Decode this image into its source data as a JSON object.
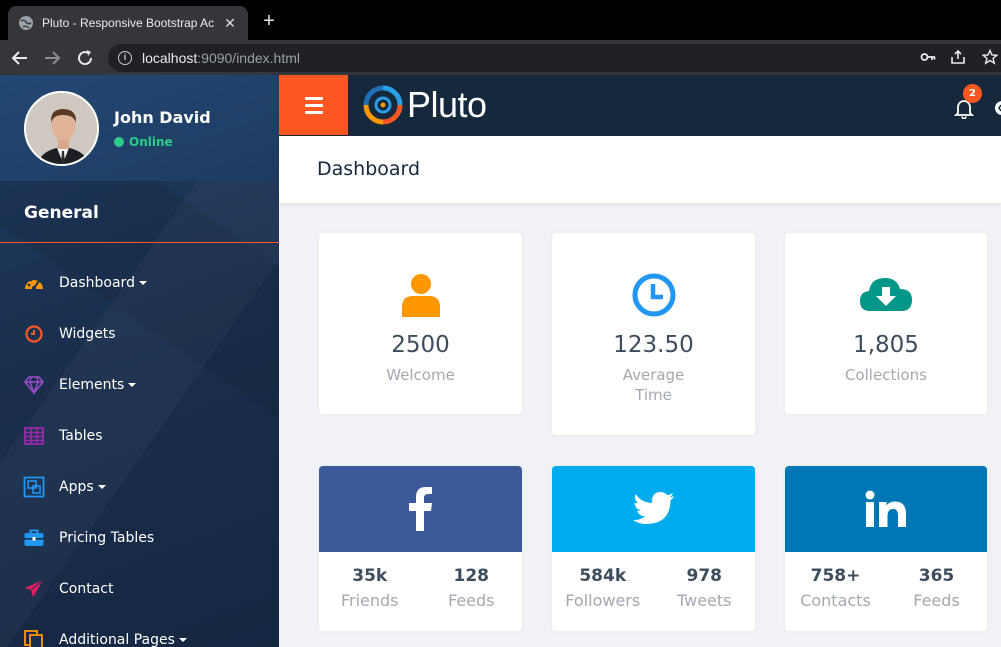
{
  "browser": {
    "tab_title": "Pluto - Responsive Bootstrap Ac",
    "url_host": "localhost",
    "url_rest": ":9090/index.html"
  },
  "sidebar": {
    "user_name": "John David",
    "user_status": "Online",
    "section_title": "General",
    "items": [
      {
        "label": "Dashboard",
        "icon": "dashboard-icon",
        "dropdown": true,
        "color": "#ff9800"
      },
      {
        "label": "Widgets",
        "icon": "clock-icon",
        "dropdown": false,
        "color": "#ff5722"
      },
      {
        "label": "Elements",
        "icon": "diamond-icon",
        "dropdown": true,
        "color": "#9c4dcc"
      },
      {
        "label": "Tables",
        "icon": "table-icon",
        "dropdown": false,
        "color": "#9c27b0"
      },
      {
        "label": "Apps",
        "icon": "apps-icon",
        "dropdown": true,
        "color": "#2196f3"
      },
      {
        "label": "Pricing Tables",
        "icon": "briefcase-icon",
        "dropdown": false,
        "color": "#2196f3"
      },
      {
        "label": "Contact",
        "icon": "paper-plane-icon",
        "dropdown": false,
        "color": "#e91e63"
      },
      {
        "label": "Additional Pages",
        "icon": "copy-icon",
        "dropdown": true,
        "color": "#ff9800"
      }
    ]
  },
  "topbar": {
    "brand": "Pluto",
    "notification_count": "2"
  },
  "page": {
    "title": "Dashboard"
  },
  "stats": [
    {
      "value": "2500",
      "label": "Welcome",
      "label2": "",
      "icon": "user-icon",
      "color": "#ff9800"
    },
    {
      "value": "123.50",
      "label": "Average",
      "label2": "Time",
      "icon": "clock-icon",
      "color": "#2196f3"
    },
    {
      "value": "1,805",
      "label": "Collections",
      "label2": "",
      "icon": "cloud-download-icon",
      "color": "#009688"
    }
  ],
  "social": [
    {
      "network": "facebook",
      "color": "#3b5998",
      "a_num": "35k",
      "a_lbl": "Friends",
      "b_num": "128",
      "b_lbl": "Feeds"
    },
    {
      "network": "twitter",
      "color": "#00aced",
      "a_num": "584k",
      "a_lbl": "Followers",
      "b_num": "978",
      "b_lbl": "Tweets"
    },
    {
      "network": "linkedin",
      "color": "#0077b5",
      "a_num": "758+",
      "a_lbl": "Contacts",
      "b_num": "365",
      "b_lbl": "Feeds"
    }
  ]
}
